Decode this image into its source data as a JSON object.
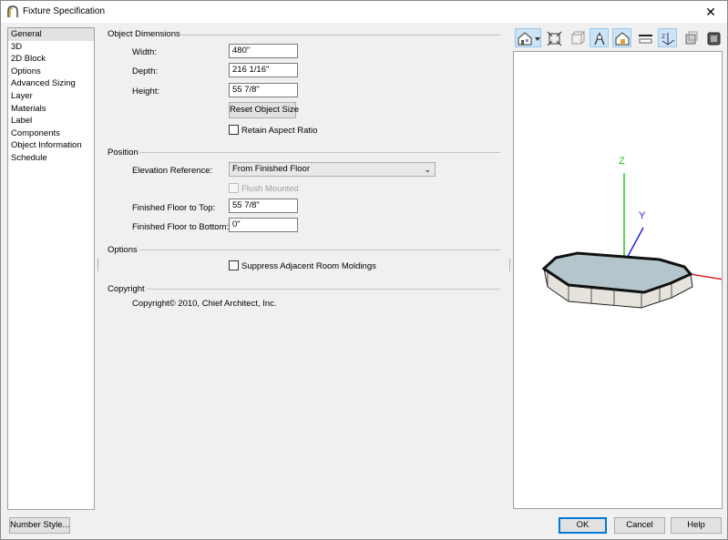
{
  "window": {
    "title": "Fixture Specification"
  },
  "sidebar": {
    "items": [
      {
        "label": "General",
        "selected": true
      },
      {
        "label": "3D"
      },
      {
        "label": "2D Block"
      },
      {
        "label": "Options"
      },
      {
        "label": "Advanced Sizing"
      },
      {
        "label": "Layer"
      },
      {
        "label": "Materials"
      },
      {
        "label": "Label"
      },
      {
        "label": "Components"
      },
      {
        "label": "Object Information"
      },
      {
        "label": "Schedule"
      }
    ]
  },
  "dimensions": {
    "section_title": "Object Dimensions",
    "width_label": "Width:",
    "width_value": "480\"",
    "depth_label": "Depth:",
    "depth_value": "216 1/16\"",
    "height_label": "Height:",
    "height_value": "55 7/8\"",
    "reset_button": "Reset Object Size",
    "retain_label": "Retain Aspect Ratio",
    "retain_checked": false
  },
  "position": {
    "section_title": "Position",
    "elevation_label": "Elevation Reference:",
    "elevation_value": "From Finished Floor",
    "flush_label": "Flush Mounted",
    "flush_checked": false,
    "top_label": "Finished Floor to Top:",
    "top_value": "55 7/8\"",
    "bottom_label": "Finished Floor to Bottom:",
    "bottom_value": "0\""
  },
  "options": {
    "section_title": "Options",
    "suppress_label": "Suppress Adjacent Room Moldings",
    "suppress_checked": false
  },
  "copyright": {
    "section_title": "Copyright",
    "text": "Copyright© 2010, Chief Architect, Inc."
  },
  "preview": {
    "toolbar_icons": [
      "camera-view-icon",
      "fit-view-icon",
      "wireframe-icon",
      "render-style-icon",
      "house-icon",
      "floor-icon",
      "axes-icon",
      "backface-icon",
      "material-icon"
    ],
    "axes": {
      "z": "Z",
      "y": "Y"
    },
    "colors": {
      "z_axis": "#22cc22",
      "y_axis": "#2222dd",
      "x_axis": "#dd2222",
      "water": "#b4c6cc"
    }
  },
  "footer": {
    "number_style": "Number Style...",
    "ok": "OK",
    "cancel": "Cancel",
    "help": "Help"
  }
}
